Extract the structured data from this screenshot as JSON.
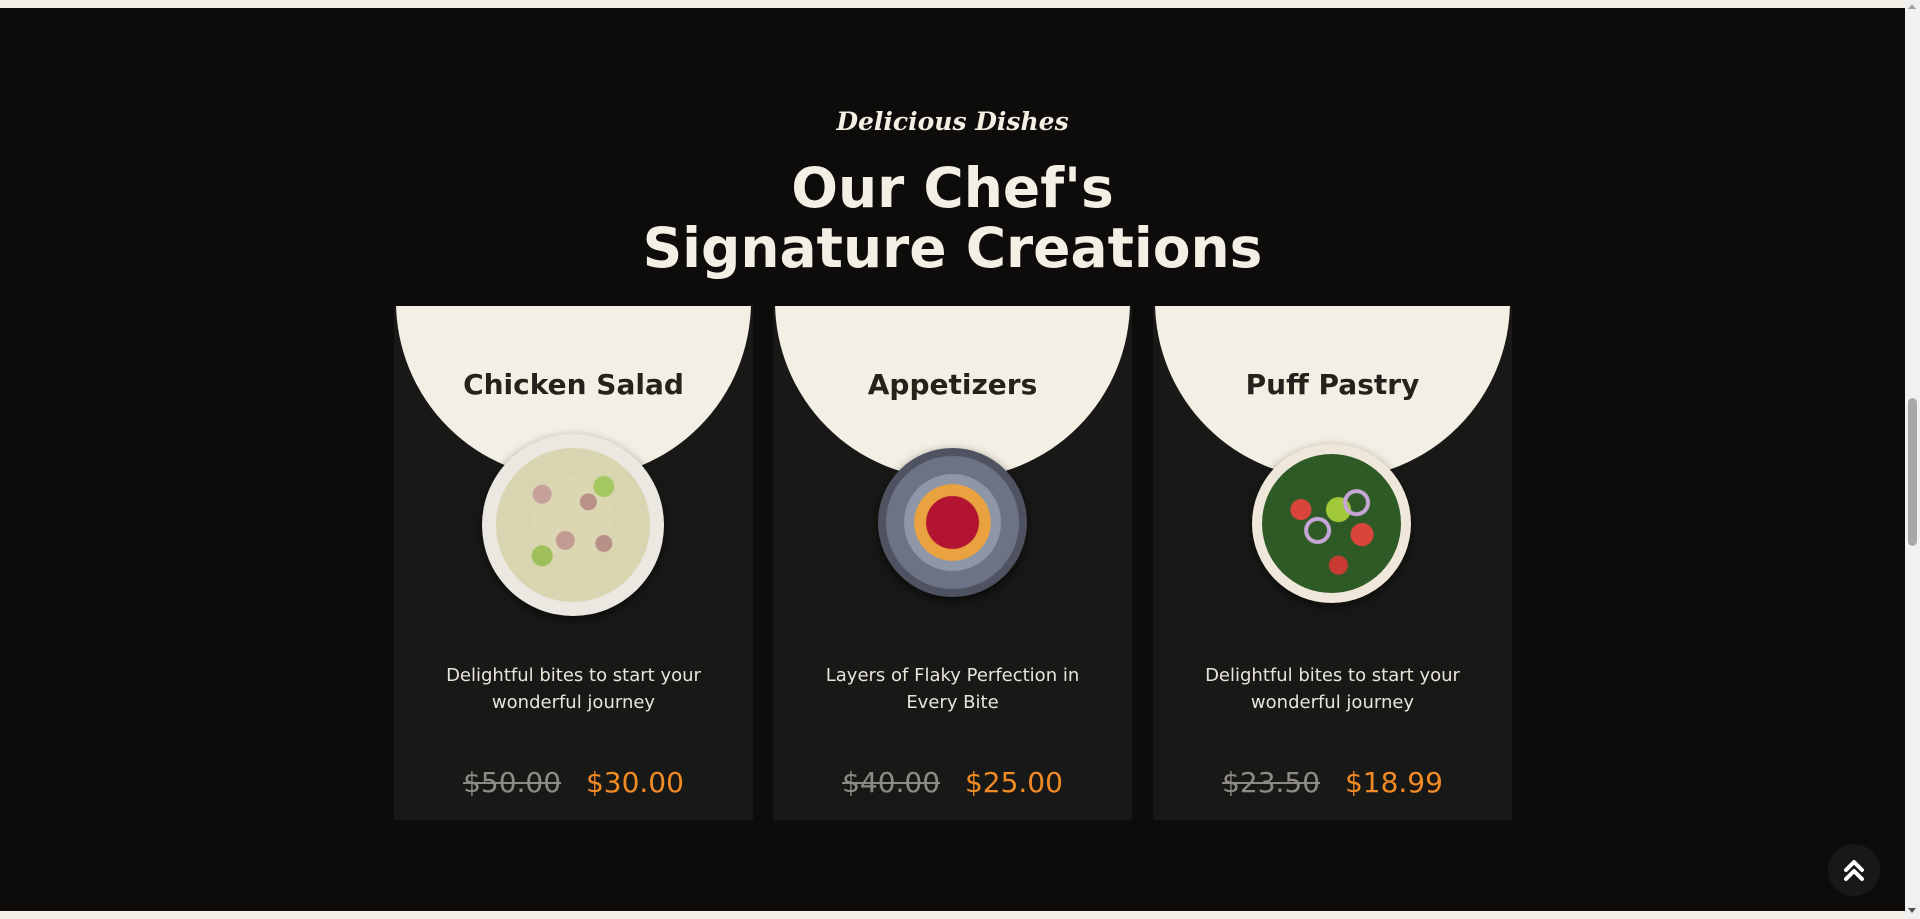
{
  "section": {
    "eyebrow": "Delicious Dishes",
    "heading_line1": "Our Chef's",
    "heading_line2": "Signature Creations"
  },
  "dishes": [
    {
      "title": "Chicken Salad",
      "description": "Delightful bites to start your wonderful journey",
      "old_price": "$50.00",
      "new_price": "$30.00"
    },
    {
      "title": "Appetizers",
      "description": "Layers of Flaky Perfection in Every Bite",
      "old_price": "$40.00",
      "new_price": "$25.00"
    },
    {
      "title": "Puff Pastry",
      "description": "Delightful bites to start your wonderful journey",
      "old_price": "$23.50",
      "new_price": "$18.99"
    }
  ],
  "scroll_top": {
    "icon": "double-chevron-up-icon"
  },
  "colors": {
    "background_dark": "#0d0c0a",
    "card_bg": "#181816",
    "cream": "#f3efe4",
    "accent_orange": "#f08a24",
    "strike_grey": "#8d8a84"
  }
}
